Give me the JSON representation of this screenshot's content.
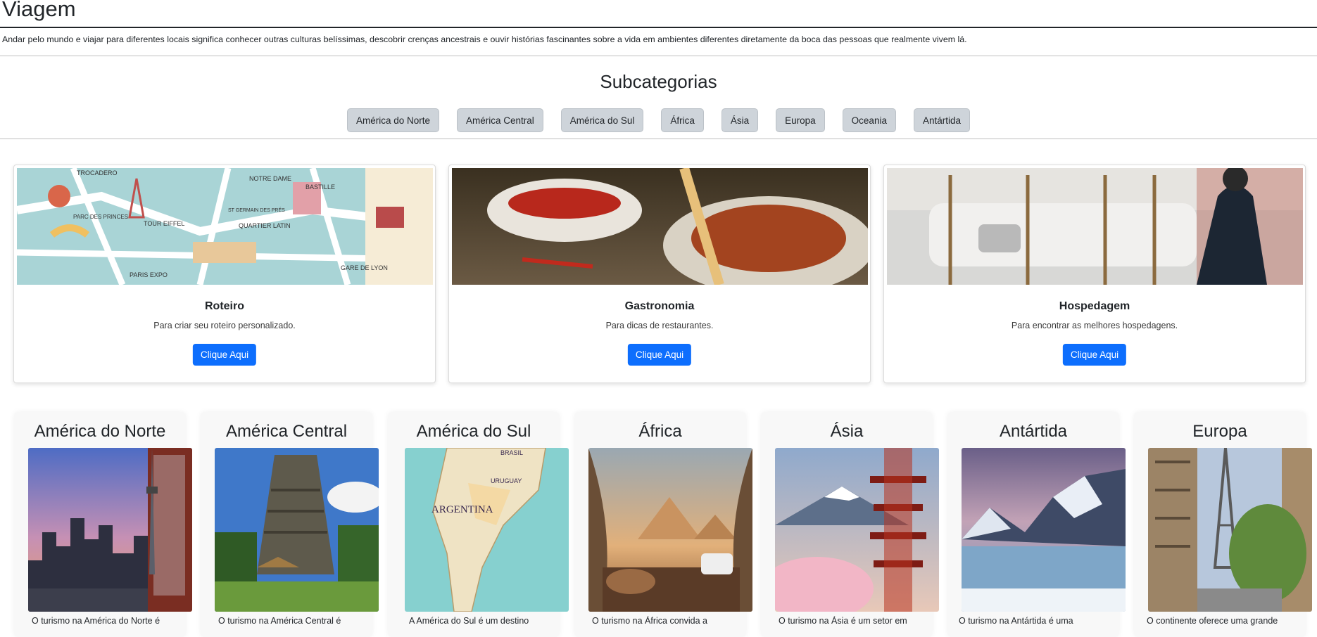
{
  "header": {
    "title": "Viagem",
    "intro": "Andar pelo mundo e viajar para diferentes locais significa conhecer outras culturas belíssimas, descobrir crenças ancestrais e ouvir histórias fascinantes sobre a vida em ambientes diferentes diretamente da boca das pessoas que realmente vivem lá."
  },
  "subcategories": {
    "title": "Subcategorias",
    "chips": [
      "América do Norte",
      "América Central",
      "América do Sul",
      "África",
      "Ásia",
      "Europa",
      "Oceania",
      "Antártida"
    ]
  },
  "cards": [
    {
      "title": "Roteiro",
      "text": "Para criar seu roteiro personalizado.",
      "button": "Clique Aqui",
      "image_labels": [
        "TROCADERO",
        "NOTRE DAME",
        "BASTILLE",
        "PARC DES PRINCES",
        "TOUR EIFFEL",
        "ST GERMAIN DES PRÉS",
        "QUARTIER LATIN",
        "PARIS EXPO",
        "GARE DE LYON"
      ]
    },
    {
      "title": "Gastronomia",
      "text": "Para dicas de restaurantes.",
      "button": "Clique Aqui"
    },
    {
      "title": "Hospedagem",
      "text": "Para encontrar as melhores hospedagens.",
      "button": "Clique Aqui"
    }
  ],
  "regions": [
    {
      "title": "América do Norte",
      "text": "O turismo na América do Norte é"
    },
    {
      "title": "América Central",
      "text": "O turismo na América Central é"
    },
    {
      "title": "América do Sul",
      "text": "A América do Sul é um destino",
      "image_labels": [
        "ARGENTINA",
        "BRASIL",
        "URUGUAY"
      ]
    },
    {
      "title": "África",
      "text": "O turismo na África convida a"
    },
    {
      "title": "Ásia",
      "text": "O turismo na Ásia é um setor em"
    },
    {
      "title": "Antártida",
      "text": "O turismo na Antártida é uma"
    },
    {
      "title": "Europa",
      "text": "O continente oferece uma grande"
    }
  ],
  "colors": {
    "primary_button": "#0d6efd",
    "chip": "#ced4da"
  }
}
